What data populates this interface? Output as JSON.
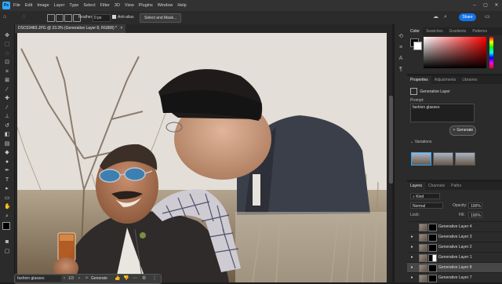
{
  "app": {
    "logo": "Ps",
    "accent": "#31a8ff"
  },
  "menu": [
    "File",
    "Edit",
    "Image",
    "Layer",
    "Type",
    "Select",
    "Filter",
    "3D",
    "View",
    "Plugins",
    "Window",
    "Help"
  ],
  "window_controls": {
    "minimize": "–",
    "maximize": "▢",
    "close": "✕"
  },
  "options_bar": {
    "feather_label": "Feather:",
    "feather_value": "0 px",
    "antialias_label": "Anti-alias",
    "select_mask_label": "Select and Mask...",
    "share_label": "Share",
    "share_color": "#1473e6"
  },
  "document": {
    "tab_title": "DSC03483.JPG @ 33.3% (Generative Layer 8, RGB/8) *",
    "tab_close": "×"
  },
  "contextual_bar": {
    "prompt_value": "fashion glasses",
    "page": "1/3",
    "generate_label": "Generate"
  },
  "color_panel": {
    "tabs": [
      "Color",
      "Swatches",
      "Gradients",
      "Patterns"
    ],
    "foreground": "#000000",
    "background": "#ffffff"
  },
  "properties_panel": {
    "tabs": [
      "Properties",
      "Adjustments",
      "Libraries"
    ],
    "layer_name": "Generative Layer",
    "prompt_label": "Prompt:",
    "prompt_value": "fashion glasses",
    "generate_label": "Generate",
    "variations_label": "Variations"
  },
  "layers_panel": {
    "tabs": [
      "Layers",
      "Channels",
      "Paths"
    ],
    "kind_label": "Kind",
    "blend_mode": "Normal",
    "opacity_label": "Opacity:",
    "opacity_value": "100%",
    "lock_label": "Lock:",
    "fill_label": "Fill:",
    "fill_value": "100%",
    "layers": [
      {
        "name": "Generative Layer 4",
        "visible": false,
        "selected": false
      },
      {
        "name": "Generative Layer 3",
        "visible": true,
        "selected": false
      },
      {
        "name": "Generative Layer 2",
        "visible": true,
        "selected": false
      },
      {
        "name": "Generative Layer 1",
        "visible": true,
        "selected": false
      },
      {
        "name": "Generative Layer 8",
        "visible": true,
        "selected": true
      },
      {
        "name": "Generative Layer 7",
        "visible": true,
        "selected": false
      }
    ]
  }
}
